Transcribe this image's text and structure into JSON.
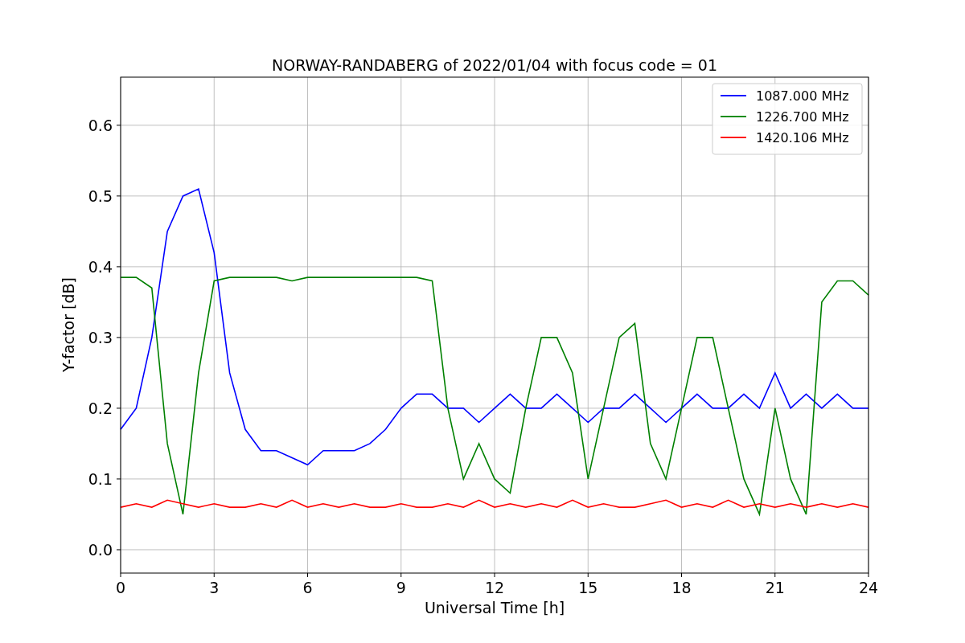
{
  "figure": {
    "chart_data": {
      "type": "line",
      "title": "NORWAY-RANDABERG of 2022/01/04 with focus code = 01",
      "xlabel": "Universal Time [h]",
      "ylabel": "Y-factor [dB]",
      "x": [
        0,
        0.5,
        1,
        1.5,
        2,
        2.5,
        3,
        3.5,
        4,
        4.5,
        5,
        5.5,
        6,
        6.5,
        7,
        7.5,
        8,
        8.5,
        9,
        9.5,
        10,
        10.5,
        11,
        11.5,
        12,
        12.5,
        13,
        13.5,
        14,
        14.5,
        15,
        15.5,
        16,
        16.5,
        17,
        17.5,
        18,
        18.5,
        19,
        19.5,
        20,
        20.5,
        21,
        21.5,
        22,
        22.5,
        23,
        23.5,
        24
      ],
      "series": [
        {
          "name": "1087.000 MHz",
          "color": "#0000ff",
          "values": [
            0.17,
            0.2,
            0.3,
            0.45,
            0.5,
            0.51,
            0.42,
            0.25,
            0.17,
            0.14,
            0.14,
            0.13,
            0.12,
            0.14,
            0.14,
            0.14,
            0.15,
            0.17,
            0.2,
            0.22,
            0.22,
            0.2,
            0.2,
            0.18,
            0.2,
            0.22,
            0.2,
            0.2,
            0.22,
            0.2,
            0.18,
            0.2,
            0.2,
            0.22,
            0.2,
            0.18,
            0.2,
            0.22,
            0.2,
            0.2,
            0.22,
            0.2,
            0.25,
            0.2,
            0.22,
            0.2,
            0.22,
            0.2,
            0.2
          ]
        },
        {
          "name": "1226.700 MHz",
          "color": "#008000",
          "values": [
            0.385,
            0.385,
            0.37,
            0.15,
            0.05,
            0.25,
            0.38,
            0.385,
            0.385,
            0.385,
            0.385,
            0.38,
            0.385,
            0.385,
            0.385,
            0.385,
            0.385,
            0.385,
            0.385,
            0.385,
            0.38,
            0.2,
            0.1,
            0.15,
            0.1,
            0.08,
            0.2,
            0.3,
            0.3,
            0.25,
            0.1,
            0.2,
            0.3,
            0.32,
            0.15,
            0.1,
            0.2,
            0.3,
            0.3,
            0.2,
            0.1,
            0.05,
            0.2,
            0.1,
            0.05,
            0.35,
            0.38,
            0.38,
            0.36
          ]
        },
        {
          "name": "1420.106 MHz",
          "color": "#ff0000",
          "values": [
            0.06,
            0.065,
            0.06,
            0.07,
            0.065,
            0.06,
            0.065,
            0.06,
            0.06,
            0.065,
            0.06,
            0.07,
            0.06,
            0.065,
            0.06,
            0.065,
            0.06,
            0.06,
            0.065,
            0.06,
            0.06,
            0.065,
            0.06,
            0.07,
            0.06,
            0.065,
            0.06,
            0.065,
            0.06,
            0.07,
            0.06,
            0.065,
            0.06,
            0.06,
            0.065,
            0.07,
            0.06,
            0.065,
            0.06,
            0.07,
            0.06,
            0.065,
            0.06,
            0.065,
            0.06,
            0.065,
            0.06,
            0.065,
            0.06
          ]
        }
      ],
      "grid": true,
      "legend": true,
      "xlim": [
        0,
        24
      ],
      "ylim": [
        -0.033,
        0.668
      ],
      "xticks": [
        0,
        3,
        6,
        9,
        12,
        15,
        18,
        21,
        24
      ],
      "yticks": [
        {
          "value": 0,
          "label": "0.0"
        },
        {
          "value": 0.1,
          "label": "0.1"
        },
        {
          "value": 0.2,
          "label": "0.2"
        },
        {
          "value": 0.3,
          "label": "0.3"
        },
        {
          "value": 0.4,
          "label": "0.4"
        },
        {
          "value": 0.5,
          "label": "0.5"
        },
        {
          "value": 0.6,
          "label": "0.6"
        }
      ]
    }
  }
}
